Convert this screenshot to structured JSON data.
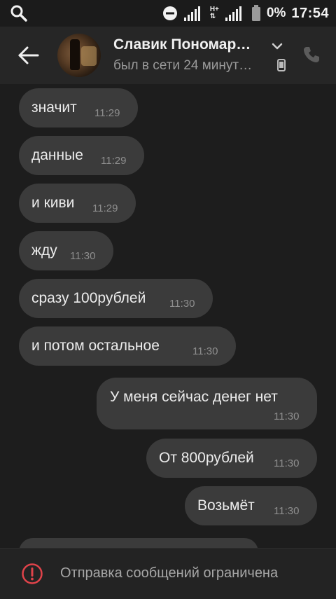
{
  "status_bar": {
    "battery_percent": "0%",
    "time": "17:54",
    "network_label": "H+",
    "icons": [
      "search-icon",
      "do-not-disturb-icon",
      "signal-icon",
      "battery-icon"
    ]
  },
  "header": {
    "contact_name": "Славик Пономар…",
    "last_seen": "был в сети 24 минут…",
    "icons": [
      "back-arrow-icon",
      "avatar",
      "chevron-down-icon",
      "mobile-device-icon",
      "phone-icon"
    ]
  },
  "messages": [
    {
      "direction": "in",
      "text": "значит",
      "time": "11:29"
    },
    {
      "direction": "in",
      "text": "данные",
      "time": "11:29"
    },
    {
      "direction": "in",
      "text": "и киви",
      "time": "11:29"
    },
    {
      "direction": "in",
      "text": "жду",
      "time": "11:30"
    },
    {
      "direction": "in",
      "text": "сразу 100рублей",
      "time": "11:30"
    },
    {
      "direction": "in",
      "text": "и потом остальное",
      "time": "11:30"
    },
    {
      "direction": "out",
      "text": "У меня сейчас денег нет",
      "time": "11:30"
    },
    {
      "direction": "out",
      "text": "От 800рублей",
      "time": "11:30"
    },
    {
      "direction": "out",
      "text": "Возьмёт",
      "time": "11:30"
    }
  ],
  "footer": {
    "restriction_text": "Отправка сообщений ограничена",
    "icon": "alert-circle-icon",
    "icon_color": "#e0434a"
  },
  "colors": {
    "background": "#1d1d1d",
    "header": "#262626",
    "bubble": "#3b3b3b"
  }
}
